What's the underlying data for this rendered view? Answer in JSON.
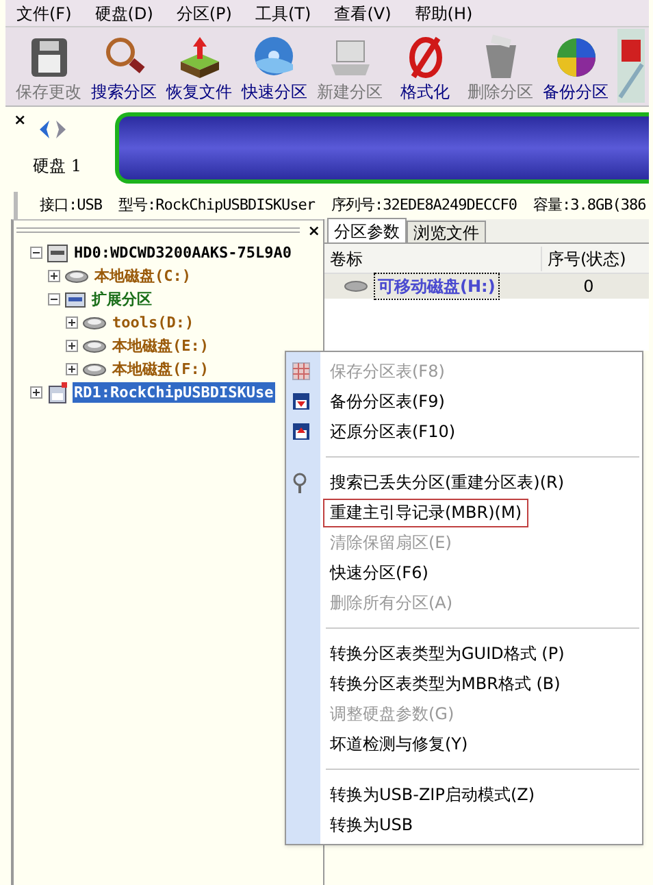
{
  "menu_bar": [
    "文件(F)",
    "硬盘(D)",
    "分区(P)",
    "工具(T)",
    "查看(V)",
    "帮助(H)"
  ],
  "toolbar": [
    {
      "label": "保存更改",
      "disabled": true
    },
    {
      "label": "搜索分区",
      "disabled": false
    },
    {
      "label": "恢复文件",
      "disabled": false
    },
    {
      "label": "快速分区",
      "disabled": false
    },
    {
      "label": "新建分区",
      "disabled": true
    },
    {
      "label": "格式化",
      "disabled": false
    },
    {
      "label": "删除分区",
      "disabled": true
    },
    {
      "label": "备份分区",
      "disabled": false
    }
  ],
  "disk_panel": {
    "close": "×",
    "name": "硬盘 1",
    "info": [
      "接口:USB",
      "型号:RockChipUSBDISKUser",
      "序列号:32EDE8A249DECCF0",
      "容量:3.8GB(386"
    ]
  },
  "tree_close": "×",
  "tree": [
    {
      "label": "HD0:WDCWD3200AAKS-75L9A0",
      "kind": "disk",
      "color": "#000000",
      "expanded": true,
      "selected": false,
      "children": [
        {
          "label": "本地磁盘(C:)",
          "kind": "partition",
          "color": "#9a5a0a",
          "expanded": false,
          "selected": false
        },
        {
          "label": "扩展分区",
          "kind": "extended",
          "color": "#1a6e1a",
          "expanded": true,
          "selected": false,
          "children": [
            {
              "label": "tools(D:)",
              "kind": "partition",
              "color": "#9a5a0a",
              "expanded": false,
              "selected": false
            },
            {
              "label": "本地磁盘(E:)",
              "kind": "partition",
              "color": "#9a5a0a",
              "expanded": false,
              "selected": false
            },
            {
              "label": "本地磁盘(F:)",
              "kind": "partition",
              "color": "#9a5a0a",
              "expanded": false,
              "selected": false
            }
          ]
        }
      ]
    },
    {
      "label": "RD1:RockChipUSBDISKUse",
      "kind": "usb",
      "expanded": false,
      "selected": true
    }
  ],
  "tabs": [
    {
      "label": "分区参数",
      "selected": true
    },
    {
      "label": "浏览文件",
      "selected": false
    }
  ],
  "table": {
    "columns": [
      "卷标",
      "序号(状态)"
    ],
    "rows": [
      [
        "可移动磁盘(H:)",
        "0"
      ]
    ]
  },
  "context_menu": [
    {
      "kind": "item",
      "label": "保存分区表(F8)",
      "disabled": true,
      "outlined": false
    },
    {
      "kind": "item",
      "label": "备份分区表(F9)",
      "disabled": false,
      "outlined": false
    },
    {
      "kind": "item",
      "label": "还原分区表(F10)",
      "disabled": false,
      "outlined": false
    },
    {
      "kind": "separator"
    },
    {
      "kind": "item",
      "label": "搜索已丢失分区(重建分区表)(R)",
      "disabled": false,
      "outlined": false
    },
    {
      "kind": "item",
      "label": "重建主引导记录(MBR)(M)",
      "disabled": false,
      "outlined": true
    },
    {
      "kind": "item",
      "label": "清除保留扇区(E)",
      "disabled": true,
      "outlined": false
    },
    {
      "kind": "item",
      "label": "快速分区(F6)",
      "disabled": false,
      "outlined": false
    },
    {
      "kind": "item",
      "label": "删除所有分区(A)",
      "disabled": true,
      "outlined": false
    },
    {
      "kind": "separator"
    },
    {
      "kind": "item",
      "label": "转换分区表类型为GUID格式 (P)",
      "disabled": false,
      "outlined": false
    },
    {
      "kind": "item",
      "label": "转换分区表类型为MBR格式 (B)",
      "disabled": false,
      "outlined": false
    },
    {
      "kind": "item",
      "label": "调整硬盘参数(G)",
      "disabled": true,
      "outlined": false
    },
    {
      "kind": "item",
      "label": "坏道检测与修复(Y)",
      "disabled": false,
      "outlined": false
    },
    {
      "kind": "separator"
    },
    {
      "kind": "item",
      "label": "转换为USB-ZIP启动模式(Z)",
      "disabled": false,
      "outlined": false
    },
    {
      "kind": "item",
      "label": "转换为USB",
      "disabled": false,
      "outlined": false
    }
  ]
}
